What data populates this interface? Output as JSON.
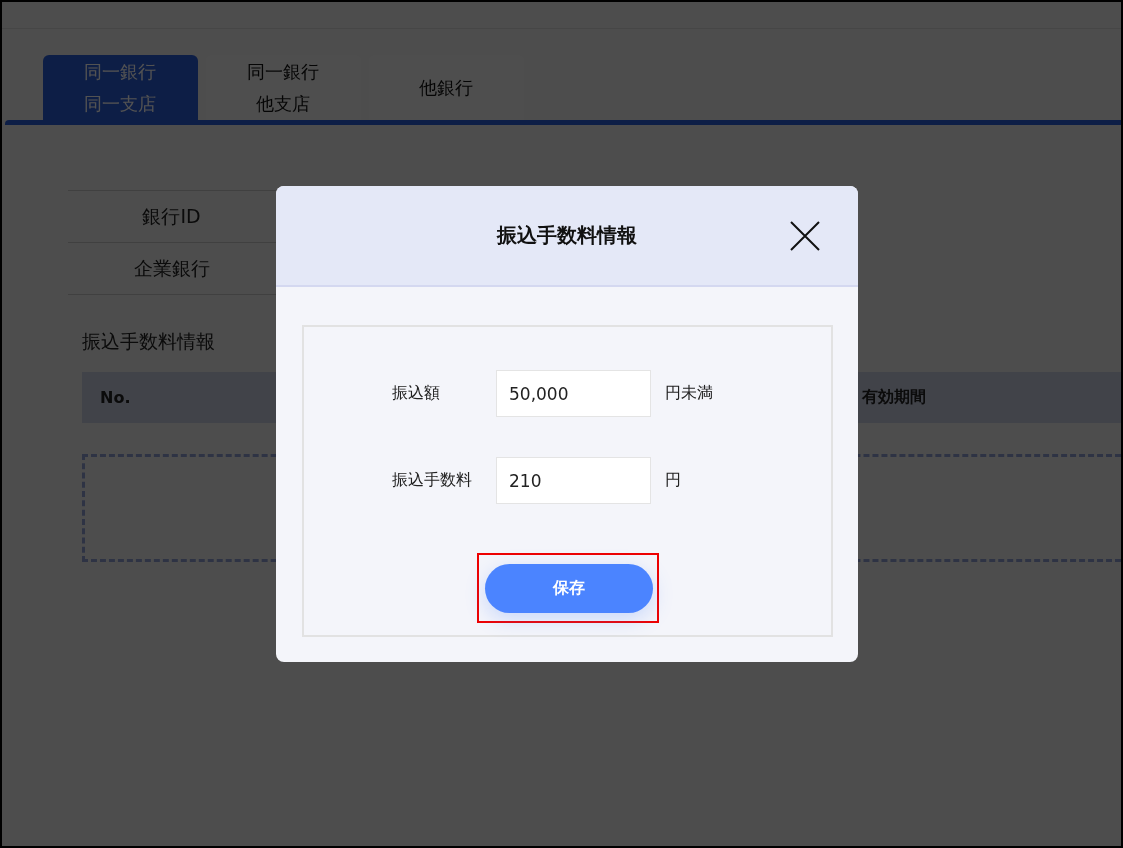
{
  "tabs": [
    {
      "label": "同一銀行同一支店",
      "selected": true
    },
    {
      "label": "同一銀行他支店",
      "selected": false
    },
    {
      "label": "他銀行",
      "selected": false
    }
  ],
  "info_table": {
    "rows": [
      {
        "label": "銀行ID"
      },
      {
        "label": "企業銀行"
      }
    ]
  },
  "section_title": "振込手数料情報",
  "fee_table": {
    "columns": [
      "No.",
      "有効期間"
    ]
  },
  "modal": {
    "title": "振込手数料情報",
    "fields": [
      {
        "label": "振込額",
        "value": "50,000",
        "unit": "円未満"
      },
      {
        "label": "振込手数料",
        "value": "210",
        "unit": "円"
      }
    ],
    "save_button": "保存"
  }
}
